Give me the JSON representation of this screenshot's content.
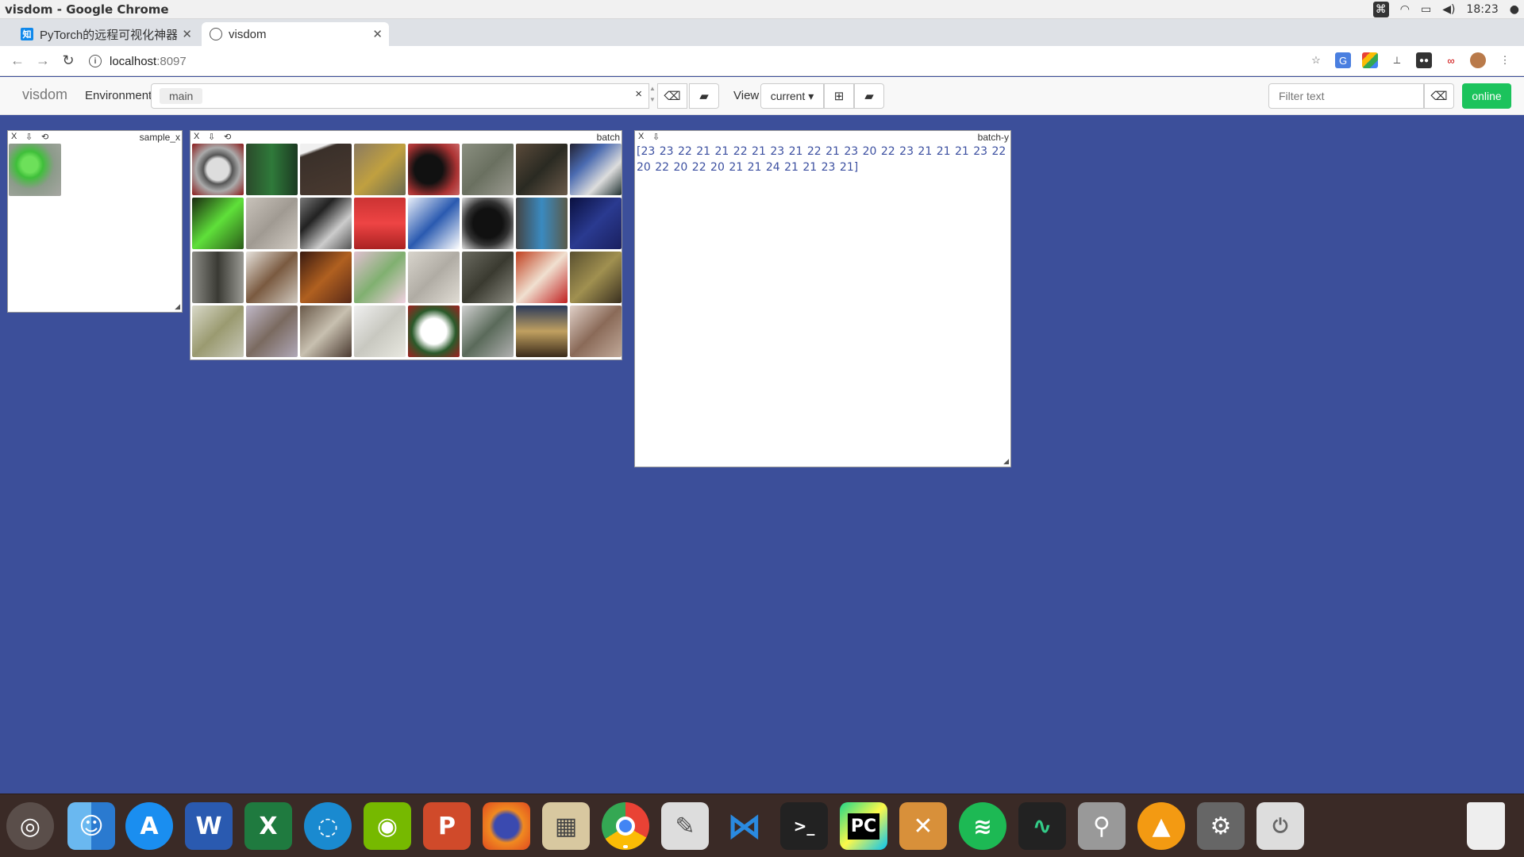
{
  "os": {
    "window_title": "visdom - Google Chrome",
    "clock": "18:23"
  },
  "browser": {
    "tabs": [
      {
        "label": "PyTorch的远程可视化神器",
        "icon": "zhihu-icon"
      },
      {
        "label": "visdom",
        "icon": "globe-icon"
      }
    ],
    "url_host": "localhost",
    "url_port": ":8097"
  },
  "visdom": {
    "brand": "visdom",
    "env_label": "Environment",
    "env_selected": "main",
    "env_clear": "×",
    "view_label": "View",
    "view_selected": "current ▾",
    "filter_placeholder": "Filter text",
    "status": "online"
  },
  "panes": {
    "sample_x": {
      "title": "sample_x",
      "close": "X",
      "save": "⇩",
      "reset": "⟲"
    },
    "batch": {
      "title": "batch",
      "close": "X",
      "save": "⇩",
      "reset": "⟲"
    },
    "batch_y": {
      "title": "batch-y",
      "close": "X",
      "save": "⇩",
      "text": "[23 23 22 21 21 22 21 23 21 22 21 23 20 22 23 21 21 21 23 22 20 22 20 22 20 21 21 24 21 21 23 21]"
    }
  },
  "colors": {
    "page_bg": "#3c4f9a",
    "online": "#1bc35c",
    "text_link": "#3b4fa0"
  },
  "dock": [
    "ubuntu-icon",
    "finder-icon",
    "app-store-icon",
    "word-icon",
    "excel-icon",
    "sync-icon",
    "nvidia-icon",
    "powerpoint-icon",
    "firefox-icon",
    "calculator-icon",
    "chrome-icon",
    "text-editor-icon",
    "vscode-icon",
    "terminal-icon",
    "pycharm-icon",
    "tools-icon",
    "spotify-icon",
    "system-monitor-icon",
    "usb-drive-icon",
    "vlc-icon",
    "settings-icon",
    "power-icon",
    "trash-icon"
  ]
}
